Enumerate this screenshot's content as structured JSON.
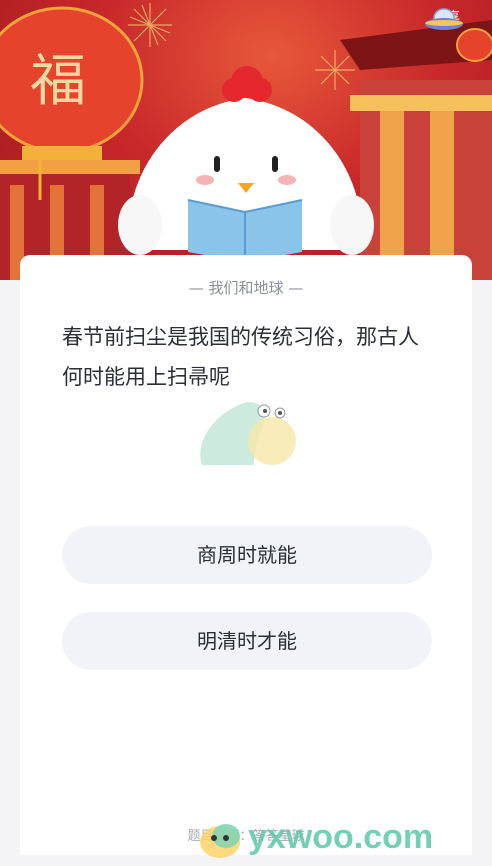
{
  "header": {
    "share_label": "分享",
    "banner_character": "福"
  },
  "quiz": {
    "source_label": "— 我们和地球 —",
    "question": "春节前扫尘是我国的传统习俗，那古人何时能用上扫帚呢",
    "options": [
      {
        "label": "商周时就能"
      },
      {
        "label": "明清时才能"
      }
    ],
    "footer": "题目来源：答答星球"
  },
  "watermark": {
    "text": "yxwoo.com"
  },
  "colors": {
    "banner_red": "#c8282a",
    "option_bg": "#f1f3f6",
    "text_dark": "#2b2f36",
    "text_muted": "#8a8f99",
    "watermark_green": "#5cc8a8"
  }
}
